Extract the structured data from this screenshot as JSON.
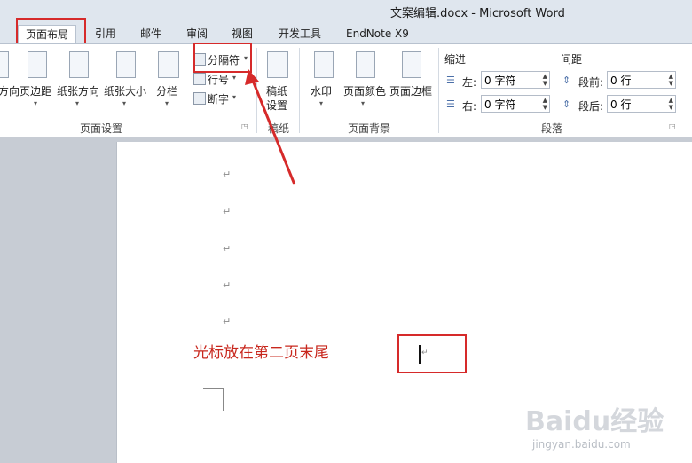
{
  "window": {
    "title": "文案编辑.docx - Microsoft Word"
  },
  "tabs": [
    {
      "label": "页面布局",
      "active": true
    },
    {
      "label": "引用"
    },
    {
      "label": "邮件"
    },
    {
      "label": "审阅"
    },
    {
      "label": "视图"
    },
    {
      "label": "开发工具"
    },
    {
      "label": "EndNote X9"
    }
  ],
  "page_setup": {
    "group_label": "页面设置",
    "buttons": [
      "方向",
      "页边距",
      "纸张方向",
      "纸张大小",
      "分栏"
    ],
    "breaks": "分隔符",
    "line_numbers": "行号",
    "hyphenation": "断字"
  },
  "manuscript": {
    "group_label": "稿纸",
    "button_line1": "稿纸",
    "button_line2": "设置"
  },
  "page_background": {
    "group_label": "页面背景",
    "buttons": [
      "水印",
      "页面颜色",
      "页面边框"
    ]
  },
  "paragraph": {
    "group_label": "段落",
    "indent_header": "缩进",
    "spacing_header": "间距",
    "left_label": "左:",
    "left_value": "0 字符",
    "right_label": "右:",
    "right_value": "0 字符",
    "before_label": "段前:",
    "before_value": "0 行",
    "after_label": "段后:",
    "after_value": "0 行"
  },
  "document": {
    "paragraph_mark": "↵",
    "annotation_text": "光标放在第二页末尾"
  },
  "watermark": {
    "main": "Baidu经验",
    "sub": "jingyan.baidu.com"
  },
  "colors": {
    "annotation": "#d62a2a",
    "ribbon_bg": "#ffffff",
    "tab_strip": "#dfe6ee"
  }
}
